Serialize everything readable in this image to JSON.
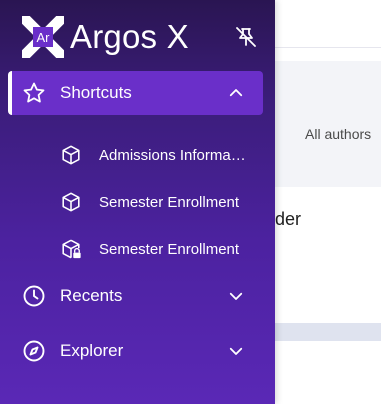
{
  "brand": {
    "logo_text": "Ar",
    "name": "Argos X"
  },
  "icons": {
    "unpin": "unpin-icon",
    "shortcuts": "star-icon",
    "recents": "clock-icon",
    "explorer": "compass-icon",
    "cube": "cube-icon",
    "cube_locked": "cube-lock-icon"
  },
  "nav": {
    "shortcuts_label": "Shortcuts",
    "recents_label": "Recents",
    "explorer_label": "Explorer"
  },
  "shortcuts": [
    {
      "label": "Admissions Information"
    },
    {
      "label": "Semester Enrollment"
    },
    {
      "label": "Semester Enrollment"
    }
  ],
  "main": {
    "filter_label": "All authors",
    "row_text": "der"
  },
  "colors": {
    "sidebar_top": "#2a1552",
    "sidebar_bottom": "#5a28b6",
    "active_item": "#6a2fc9",
    "logo_accent": "#6a2fc9"
  }
}
